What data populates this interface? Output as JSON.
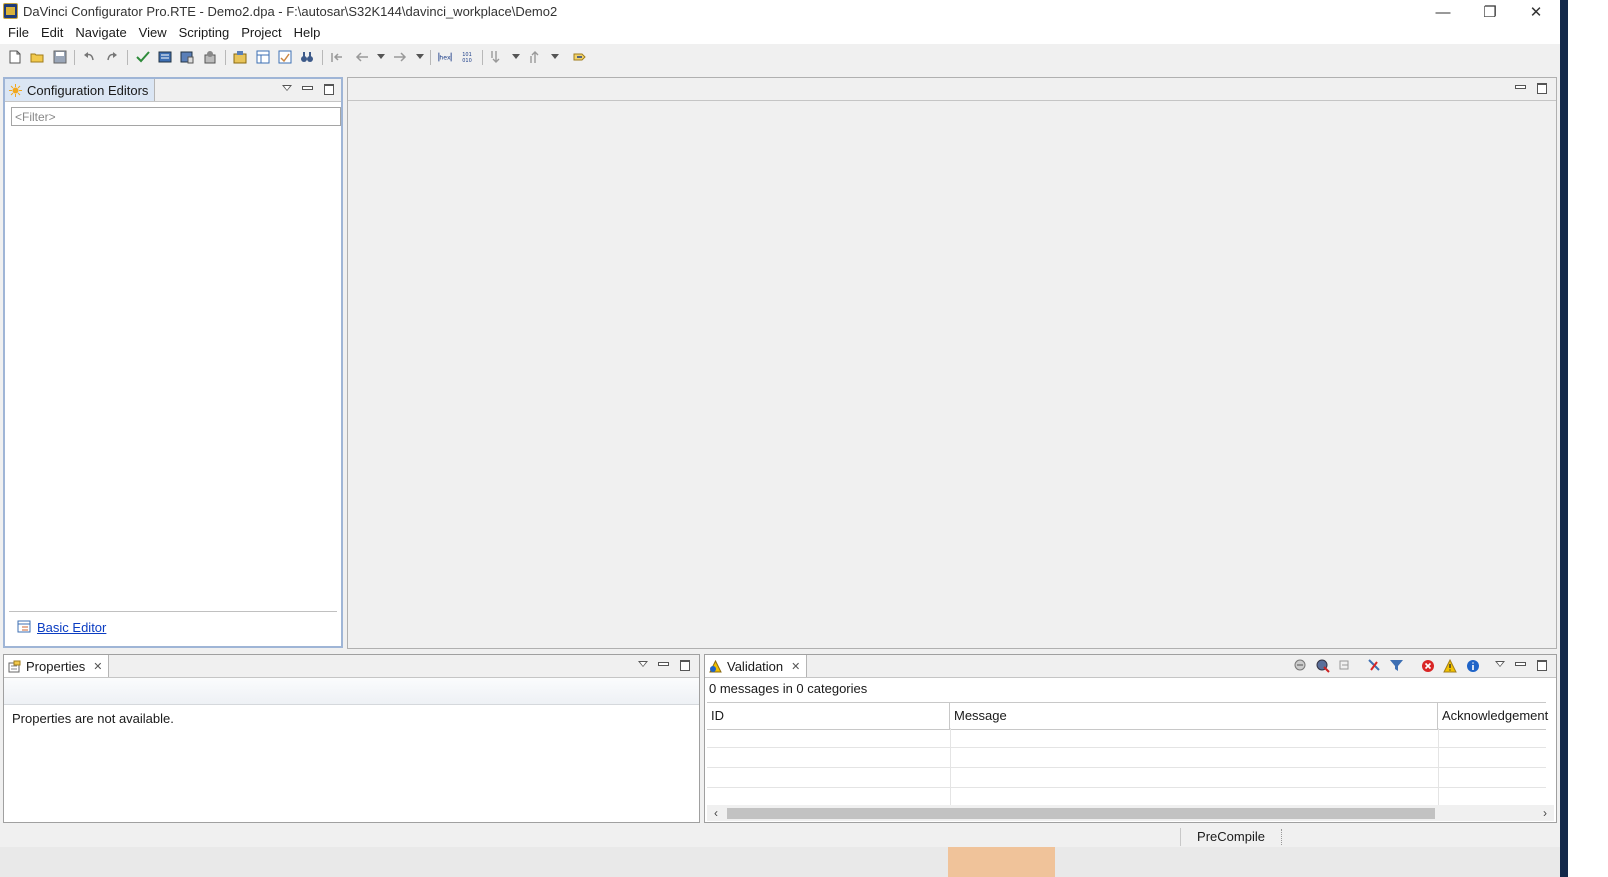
{
  "window": {
    "title": "DaVinci Configurator Pro.RTE - Demo2.dpa - F:\\autosar\\S32K144\\davinci_workplace\\Demo2",
    "minimize": "—",
    "restore": "❐",
    "close": "✕"
  },
  "menu": [
    "File",
    "Edit",
    "Navigate",
    "View",
    "Scripting",
    "Project",
    "Help"
  ],
  "toolbar": {
    "icons": [
      "new-file-icon",
      "open-folder-icon",
      "save-icon",
      "undo-icon",
      "redo-icon",
      "validate-icon",
      "generate-icon",
      "database-icon",
      "tools-icon",
      "project-settings-icon",
      "module-view-icon",
      "input-files-icon",
      "search-binoculars-icon",
      "nav-back-icon",
      "prev-icon",
      "next-icon",
      "hex-icon",
      "bits-icon",
      "step-down-icon",
      "step-up-icon",
      "link-icon"
    ]
  },
  "config_editors": {
    "tab_label": "Configuration Editors",
    "filter_placeholder": "<Filter>",
    "basic_editor_link": "Basic Editor"
  },
  "properties": {
    "tab_label": "Properties",
    "message": "Properties are not available."
  },
  "validation": {
    "tab_label": "Validation",
    "summary": "0 messages in 0 categories",
    "columns": [
      "ID",
      "Message",
      "Acknowledgement"
    ]
  },
  "status": {
    "mode": "PreCompile"
  },
  "colors": {
    "accent_link": "#0a3cc2",
    "active_tab": "#dbe6f4",
    "error_red": "#d92626",
    "warning_yellow": "#f2c200",
    "info_blue": "#1f64c8"
  }
}
